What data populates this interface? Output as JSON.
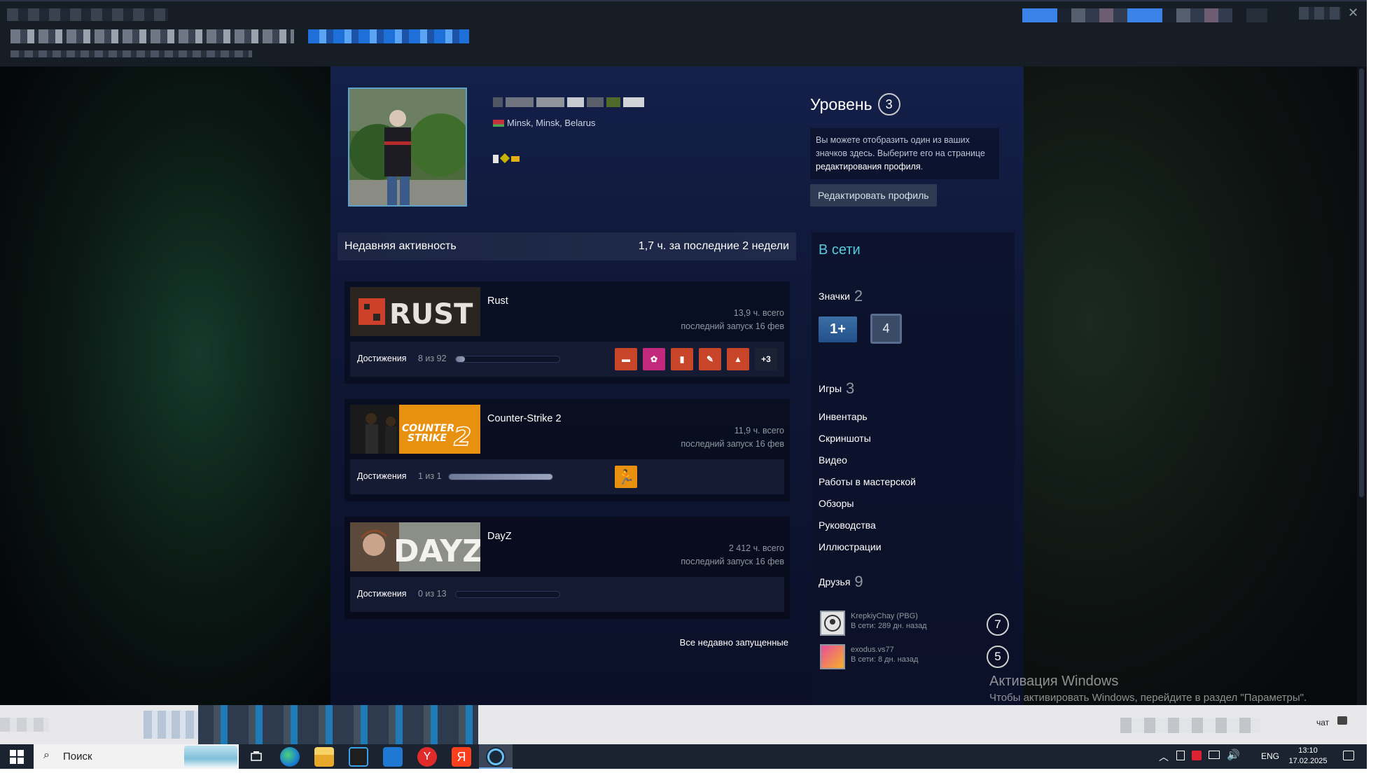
{
  "profile": {
    "location": "Minsk, Minsk, Belarus",
    "level_title": "Уровень",
    "level": "3",
    "badge_hint_text": "Вы можете отобразить один из ваших значков здесь. Выберите его на странице ",
    "badge_hint_link": "редактирования профиля",
    "badge_hint_end": ".",
    "edit_button": "Редактировать профиль"
  },
  "activity": {
    "title": "Недавняя активность",
    "summary": "1,7 ч. за последние 2 недели",
    "games": [
      {
        "name": "Rust",
        "hours": "13,9 ч. всего",
        "last": "последний запуск 16 фев",
        "ach_label": "Достижения",
        "ach_count": "8 из 92",
        "ach_fraction": 0.087,
        "ach_more": "+3"
      },
      {
        "name": "Counter-Strike 2",
        "hours": "11,9 ч. всего",
        "last": "последний запуск 16 фев",
        "ach_label": "Достижения",
        "ach_count": "1 из 1",
        "ach_fraction": 1.0
      },
      {
        "name": "DayZ",
        "hours": "2 412 ч. всего",
        "last": "последний запуск 16 фев",
        "ach_label": "Достижения",
        "ach_count": "0 из 13",
        "ach_fraction": 0.0
      }
    ],
    "all_recent": "Все недавно запущенные"
  },
  "sidebar": {
    "status": "В сети",
    "badges_label": "Значки",
    "badges_count": "2",
    "badge1": "1+",
    "badge2": "4",
    "games_label": "Игры",
    "games_count": "3",
    "links": [
      "Инвентарь",
      "Скриншоты",
      "Видео",
      "Работы в мастерской",
      "Обзоры",
      "Руководства",
      "Иллюстрации"
    ],
    "friends_label": "Друзья",
    "friends_count": "9",
    "friends": [
      {
        "name": "KrepkiyChay (PBG)",
        "status": "В сети: 289 дн. назад",
        "level": "7"
      },
      {
        "name": "exodus.vs77",
        "status": "В сети: 8 дн. назад",
        "level": "5"
      }
    ]
  },
  "windows": {
    "activation_title": "Активация Windows",
    "activation_text": "Чтобы активировать Windows, перейдите в раздел \"Параметры\".",
    "search_placeholder": "Поиск",
    "chat": "чат",
    "lang": "ENG",
    "time": "13:10",
    "date": "17.02.2025"
  },
  "colors": {
    "accent_status": "#57cbde",
    "page_bg": "#0f1838",
    "taskbar": "#1b2330"
  }
}
